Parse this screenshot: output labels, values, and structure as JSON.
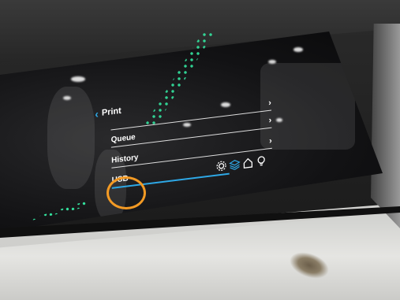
{
  "screen": {
    "header": {
      "back_icon": "chevron-left-icon",
      "title": "Print"
    },
    "menu": [
      {
        "label": "Queue",
        "chevron": "›"
      },
      {
        "label": "History",
        "chevron": "›"
      },
      {
        "label": "USB",
        "chevron": "›"
      }
    ],
    "toolbar_icons": [
      "gear-icon",
      "layers-icon",
      "home-icon",
      "lightbulb-icon"
    ],
    "colors": {
      "accent": "#2ea8e6",
      "highlight": "#f39a24",
      "text": "#ffffff"
    }
  }
}
